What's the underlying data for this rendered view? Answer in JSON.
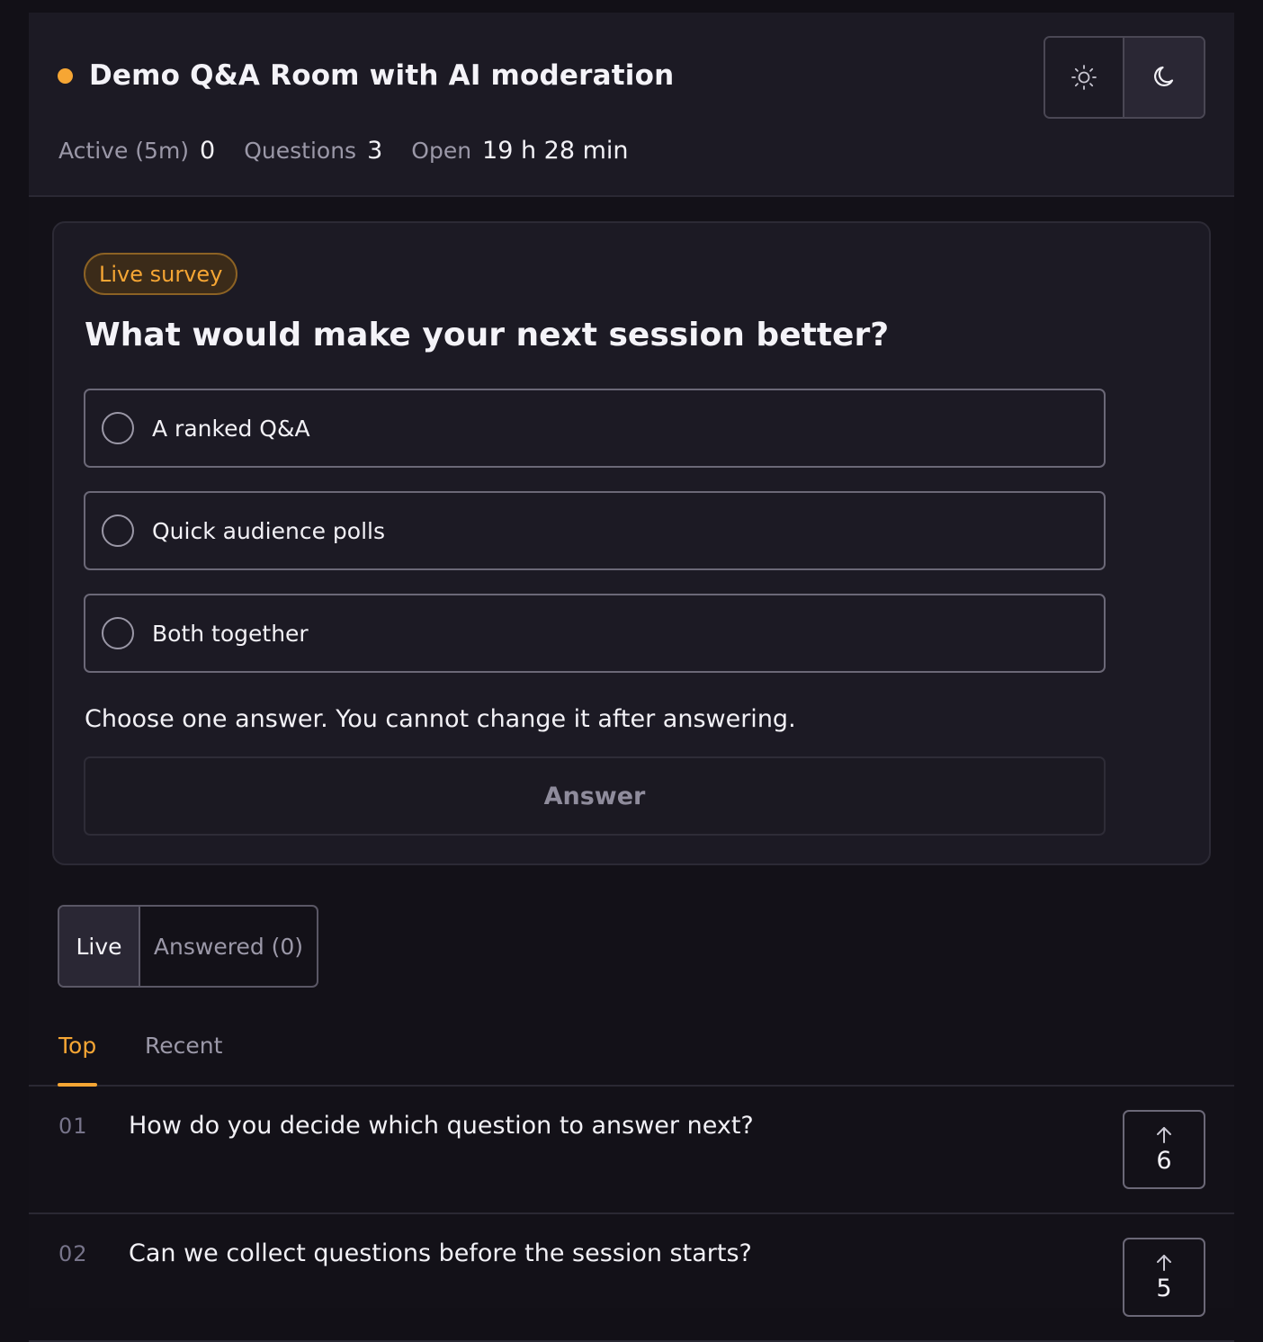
{
  "header": {
    "title": "Demo Q&A Room with AI moderation",
    "status_color": "#f6a634",
    "stats": {
      "active_label": "Active (5m)",
      "active_value": "0",
      "questions_label": "Questions",
      "questions_value": "3",
      "open_label": "Open",
      "open_value": "19 h 28 min"
    },
    "theme_toggle": {
      "light_icon": "sun-icon",
      "dark_icon": "moon-icon",
      "selected": "dark"
    }
  },
  "survey": {
    "badge": "Live survey",
    "question": "What would make your next session better?",
    "options": [
      {
        "label": "A ranked Q&A"
      },
      {
        "label": "Quick audience polls"
      },
      {
        "label": "Both together"
      }
    ],
    "hint": "Choose one answer. You cannot change it after answering.",
    "answer_label": "Answer"
  },
  "view_toggle": {
    "live_label": "Live",
    "answered_label": "Answered (0)",
    "selected": "Live"
  },
  "sort_tabs": {
    "top_label": "Top",
    "recent_label": "Recent",
    "selected": "Top",
    "accent": "#f6a634"
  },
  "questions": [
    {
      "num": "01",
      "text": "How do you decide which question to answer next?",
      "votes": "6",
      "vote_icon": "arrow-up-icon"
    },
    {
      "num": "02",
      "text": "Can we collect questions before the session starts?",
      "votes": "5",
      "vote_icon": "arrow-up-icon"
    }
  ]
}
